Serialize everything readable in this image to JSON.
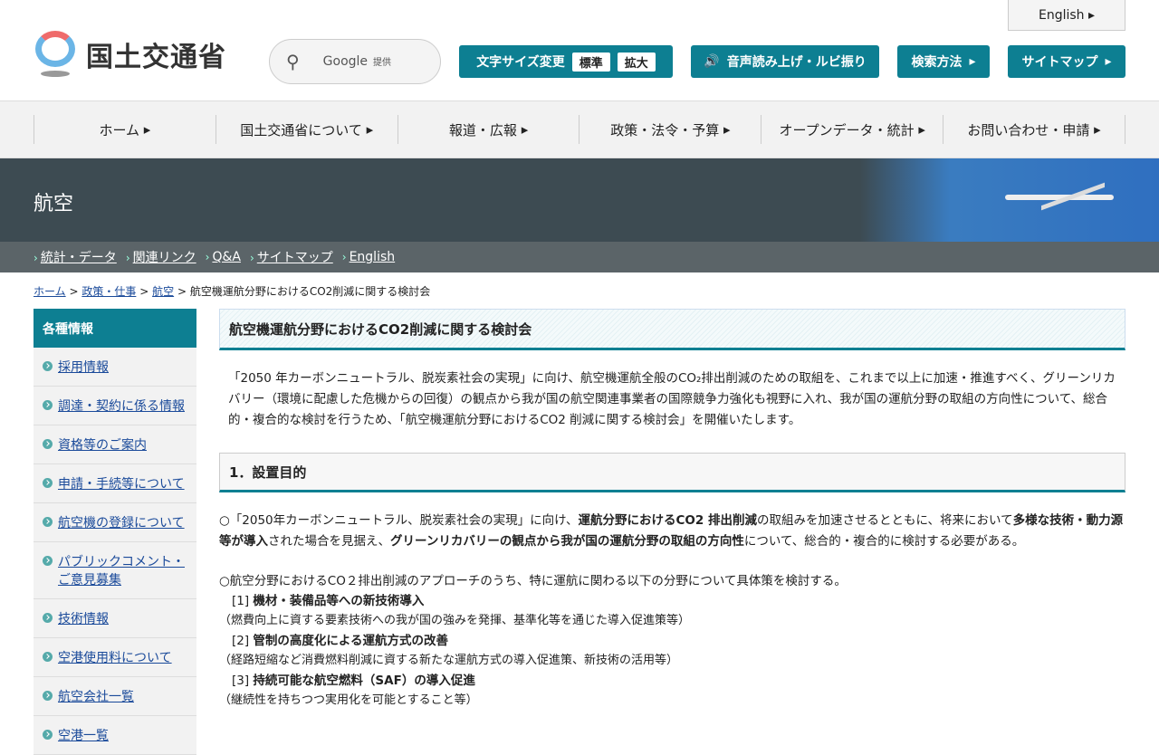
{
  "header": {
    "logo_text": "国土交通省",
    "search_label": "Google",
    "search_sub": "提供",
    "english": "English",
    "font_size": "文字サイズ変更",
    "font_std": "標準",
    "font_large": "拡大",
    "speech": "音声読み上げ・ルビ振り",
    "search_method": "検索方法",
    "sitemap": "サイトマップ"
  },
  "gnav": [
    "ホーム",
    "国土交通省について",
    "報道・広報",
    "政策・法令・予算",
    "オープンデータ・統計",
    "お問い合わせ・申請"
  ],
  "banner": {
    "title": "航空"
  },
  "subnav": [
    "統計・データ",
    "関連リンク",
    "Q&A",
    "サイトマップ",
    "English"
  ],
  "breadcrumb": {
    "items": [
      "ホーム",
      "政策・仕事",
      "航空"
    ],
    "sep": ">",
    "current": "航空機運航分野におけるCO2削減に関する検討会"
  },
  "sidebar": {
    "title": "各種情報",
    "items": [
      "採用情報",
      "調達・契約に係る情報",
      "資格等のご案内",
      "申請・手続等について",
      "航空機の登録について",
      "パブリックコメント・ご意見募集",
      "技術情報",
      "空港使用料について",
      "航空会社一覧",
      "空港一覧"
    ]
  },
  "main": {
    "title": "航空機運航分野におけるCO2削減に関する検討会",
    "intro": "「2050 年カーボンニュートラル、脱炭素社会の実現」に向け、航空機運航全般のCO₂排出削減のための取組を、これまで以上に加速・推進すべく、グリーンリカバリー（環境に配慮した危機からの回復）の観点から我が国の航空関連事業者の国際競争力強化も視野に入れ、我が国の運航分野の取組の方向性について、総合的・複合的な検討を行うため、「航空機運航分野におけるCO2 削減に関する検討会」を開催いたします。",
    "section1": "1．設置目的",
    "p1": [
      "○「2050年カーボンニュートラル、脱炭素社会の実現」に向け、",
      "運航分野におけるCO2 排出削減",
      "の取組みを加速させるとともに、将来において",
      "多様な技術・動力源等が導入",
      "された場合を見据え、",
      "グリーンリカバリーの観点から我が国の運航分野の取組の方向性",
      "について、総合的・複合的に検討する必要がある。"
    ],
    "p2": "○航空分野におけるCO２排出削減のアプローチのうち、特に運航に関わる以下の分野について具体策を検討する。",
    "items": [
      {
        "num": "[1]",
        "title": "機材・装備品等への新技術導入",
        "desc": "（燃費向上に資する要素技術への我が国の強みを発揮、基準化等を通じた導入促進策等）"
      },
      {
        "num": "[2]",
        "title": "管制の高度化による運航方式の改善",
        "desc": "（経路短縮など消費燃料削減に資する新たな運航方式の導入促進策、新技術の活用等）"
      },
      {
        "num": "[3]",
        "title": "持続可能な航空燃料（SAF）の導入促進",
        "desc": "（継続性を持ちつつ実用化を可能とすること等）"
      }
    ]
  }
}
